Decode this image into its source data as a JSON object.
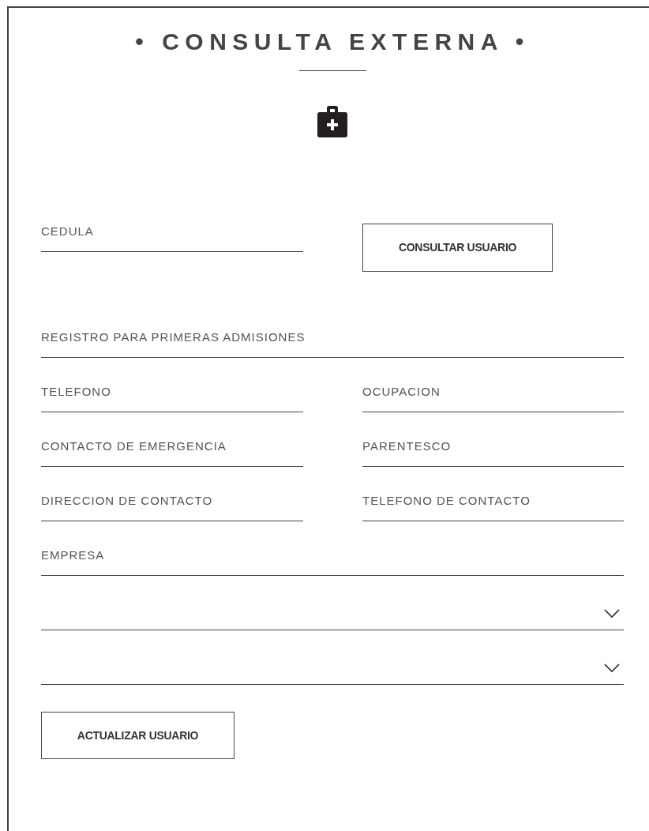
{
  "title": "• CONSULTA EXTERNA •",
  "lookup": {
    "field": {
      "placeholder": "CEDULA"
    },
    "button": "CONSULTAR USUARIO"
  },
  "rows": [
    [
      {
        "kind": "text",
        "placeholder": "REGISTRO PARA PRIMERAS ADMISIONES"
      }
    ],
    [
      {
        "kind": "text",
        "placeholder": "TELEFONO"
      },
      {
        "kind": "text",
        "placeholder": "OCUPACION"
      }
    ],
    [
      {
        "kind": "text",
        "placeholder": "CONTACTO DE EMERGENCIA"
      },
      {
        "kind": "text",
        "placeholder": "PARENTESCO"
      }
    ],
    [
      {
        "kind": "text",
        "placeholder": "DIRECCION DE CONTACTO"
      },
      {
        "kind": "text",
        "placeholder": "TELEFONO DE CONTACTO"
      }
    ],
    [
      {
        "kind": "text",
        "placeholder": "EMPRESA"
      }
    ],
    [
      {
        "kind": "select"
      }
    ],
    [
      {
        "kind": "select"
      }
    ]
  ],
  "submit": "ACTUALIZAR USUARIO"
}
